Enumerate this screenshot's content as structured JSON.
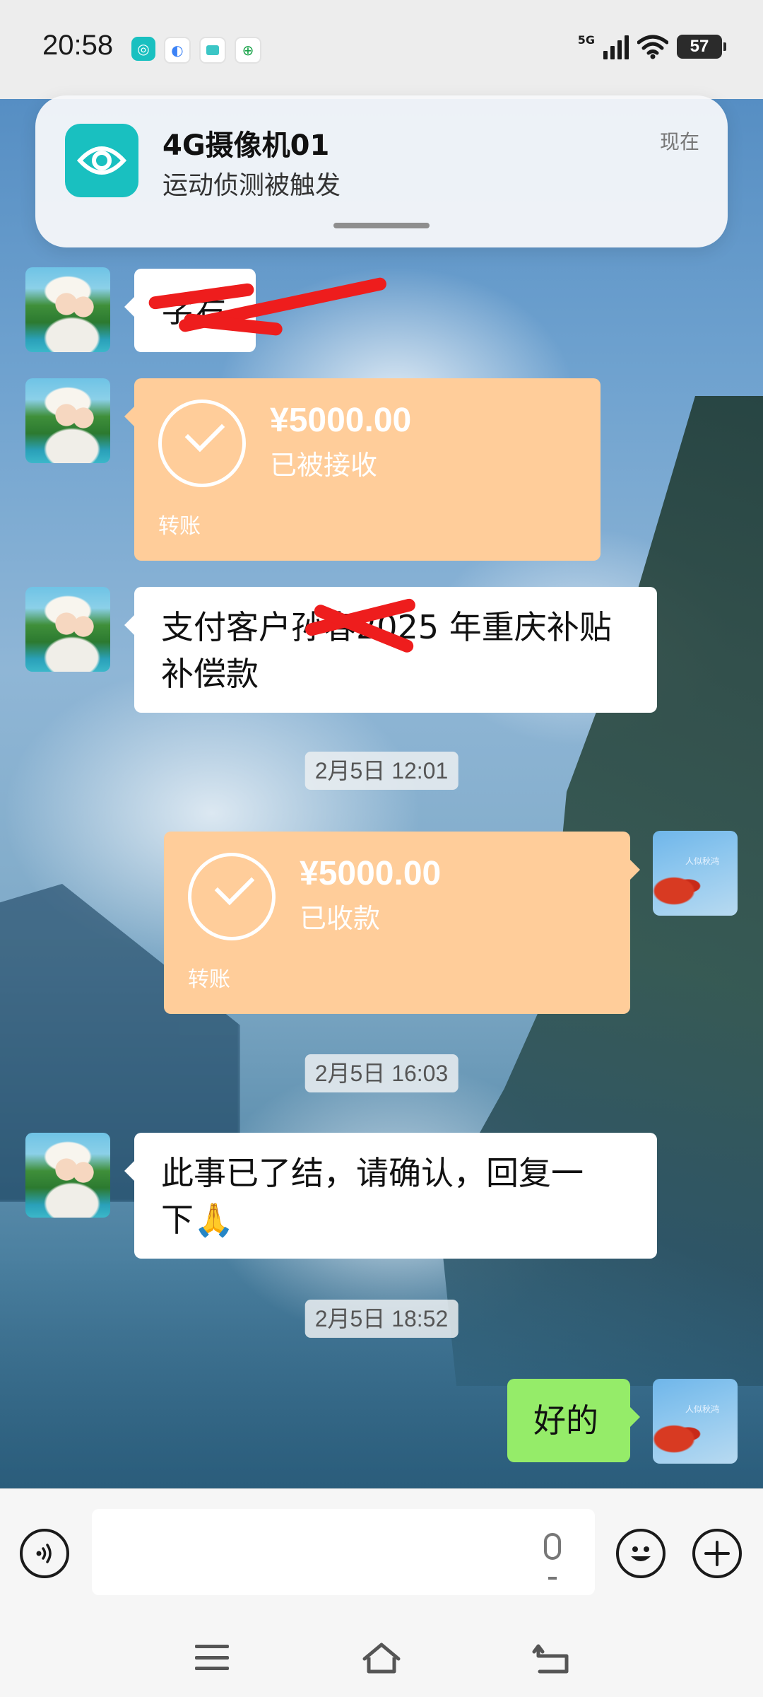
{
  "status_bar": {
    "time": "20:58",
    "network": "5G",
    "battery": "57",
    "app_icons": [
      "camera-app-icon",
      "browser-icon",
      "gallery-icon",
      "bank-app-icon"
    ]
  },
  "notification": {
    "app": "4G摄像机01",
    "message": "运动侦测被触发",
    "time": "现在",
    "icon": "camera-eye-icon"
  },
  "messages": [
    {
      "side": "left",
      "type": "text",
      "text": "字右"
    },
    {
      "side": "left",
      "type": "transfer",
      "amount": "¥5000.00",
      "status": "已被接收",
      "label": "转账"
    },
    {
      "side": "left",
      "type": "text",
      "line1": "支付客户孙春2025 年重庆补贴",
      "line2": "补偿款"
    },
    {
      "type": "timestamp",
      "text": "2月5日 12:01"
    },
    {
      "side": "right",
      "type": "transfer",
      "amount": "¥5000.00",
      "status": "已收款",
      "label": "转账"
    },
    {
      "type": "timestamp",
      "text": "2月5日 16:03"
    },
    {
      "side": "left",
      "type": "text",
      "line1": "此事已了结，请确认，回复一",
      "line2": "下🙏"
    },
    {
      "type": "timestamp",
      "text": "2月5日 18:52"
    },
    {
      "side": "right",
      "type": "text",
      "text": "好的"
    }
  ],
  "input_bar": {
    "placeholder": "",
    "icons": [
      "voice-icon",
      "microphone-icon",
      "emoji-icon",
      "plus-icon"
    ]
  },
  "colors": {
    "transfer": "#ffcd9a",
    "sent_bubble": "#95ec69",
    "received_bubble": "#ffffff"
  }
}
